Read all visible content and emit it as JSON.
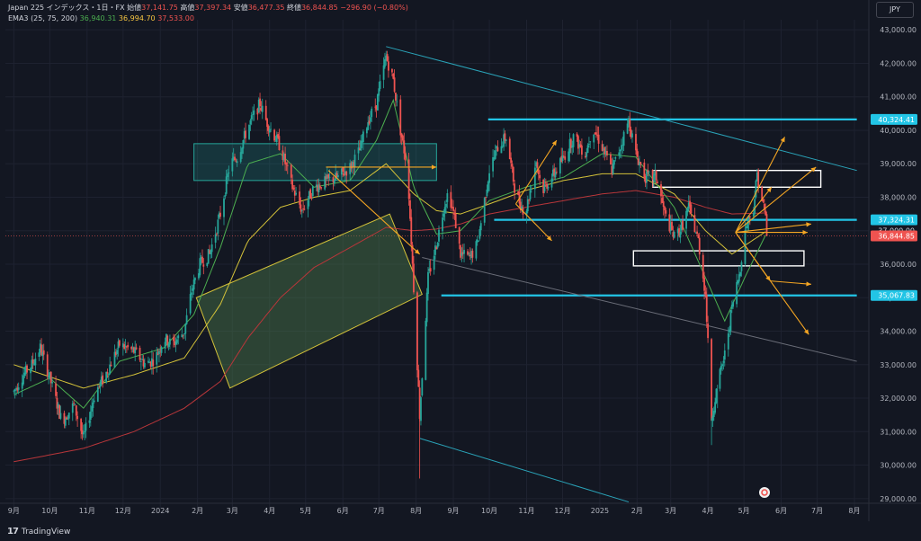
{
  "legend": {
    "symbol": "Japan 225 インデックス・1日・FX",
    "open_label": "始値",
    "open": "37,141.75",
    "high_label": "高値",
    "high": "37,397.34",
    "low_label": "安値",
    "low": "36,477.35",
    "close_label": "終値",
    "close": "36,844.85",
    "change": "−296.90 (−0.80%)",
    "ema_label": "EMA3 (25, 75, 200)",
    "ema1": "36,940.31",
    "ema2": "36,994.70",
    "ema3": "37,533.00"
  },
  "currency": "JPY",
  "brand": "TradingView",
  "colors": {
    "background": "#131722",
    "grid": "#1e2230",
    "up": "#26a69a",
    "down": "#ef5350",
    "ema25": "#4caf50",
    "ema75": "#d4c239",
    "ema200": "#b8363a",
    "level": "#22c5e6",
    "channel": "#2aa3b8",
    "arrow": "#f5a623",
    "box_green": "#4b7a4b"
  },
  "chart_data": {
    "type": "candlestick",
    "y_range": [
      28700,
      43300
    ],
    "y_ticks": [
      "29,000.00",
      "30,000.00",
      "31,000.00",
      "32,000.00",
      "33,000.00",
      "34,000.00",
      "35,000.00",
      "36,000.00",
      "37,000.00",
      "38,000.00",
      "39,000.00",
      "40,000.00",
      "41,000.00",
      "42,000.00",
      "43,000.00"
    ],
    "x_ticks": [
      "9月",
      "10月",
      "11月",
      "12月",
      "2024",
      "2月",
      "3月",
      "4月",
      "5月",
      "6月",
      "7月",
      "8月",
      "9月",
      "10月",
      "11月",
      "12月",
      "2025",
      "2月",
      "3月",
      "4月",
      "5月",
      "6月",
      "7月",
      "8月"
    ],
    "x_tick_days": [
      0,
      30,
      61,
      91,
      122,
      153,
      182,
      213,
      243,
      274,
      304,
      335,
      366,
      396,
      427,
      457,
      488,
      519,
      547,
      578,
      608,
      639,
      669,
      700
    ],
    "x_range": [
      -7,
      712
    ],
    "last_data_day": 627,
    "price_path": [
      [
        0,
        32200
      ],
      [
        8,
        32700
      ],
      [
        15,
        33000
      ],
      [
        22,
        33500
      ],
      [
        30,
        32600
      ],
      [
        40,
        31300
      ],
      [
        50,
        31800
      ],
      [
        58,
        30800
      ],
      [
        68,
        32200
      ],
      [
        75,
        32600
      ],
      [
        88,
        33600
      ],
      [
        100,
        33400
      ],
      [
        110,
        33000
      ],
      [
        118,
        33200
      ],
      [
        125,
        33800
      ],
      [
        132,
        33600
      ],
      [
        142,
        34000
      ],
      [
        148,
        35200
      ],
      [
        155,
        36000
      ],
      [
        163,
        36300
      ],
      [
        172,
        37500
      ],
      [
        180,
        39000
      ],
      [
        186,
        39200
      ],
      [
        195,
        40100
      ],
      [
        205,
        40800
      ],
      [
        210,
        40300
      ],
      [
        222,
        39500
      ],
      [
        232,
        38300
      ],
      [
        240,
        37600
      ],
      [
        250,
        38300
      ],
      [
        262,
        38500
      ],
      [
        270,
        38600
      ],
      [
        280,
        38900
      ],
      [
        288,
        39400
      ],
      [
        295,
        40300
      ],
      [
        302,
        40800
      ],
      [
        310,
        42200
      ],
      [
        316,
        41500
      ],
      [
        322,
        40000
      ],
      [
        328,
        38800
      ],
      [
        333,
        35300
      ],
      [
        338,
        31500
      ],
      [
        345,
        35600
      ],
      [
        352,
        36600
      ],
      [
        358,
        37700
      ],
      [
        362,
        38200
      ],
      [
        368,
        37200
      ],
      [
        372,
        36300
      ],
      [
        380,
        36200
      ],
      [
        386,
        36600
      ],
      [
        396,
        38800
      ],
      [
        403,
        39500
      ],
      [
        410,
        39800
      ],
      [
        418,
        38100
      ],
      [
        426,
        37500
      ],
      [
        435,
        39100
      ],
      [
        440,
        38200
      ],
      [
        448,
        38600
      ],
      [
        458,
        39200
      ],
      [
        466,
        39800
      ],
      [
        476,
        39300
      ],
      [
        482,
        40100
      ],
      [
        490,
        39500
      ],
      [
        498,
        38800
      ],
      [
        505,
        39500
      ],
      [
        512,
        40300
      ],
      [
        518,
        39300
      ],
      [
        526,
        38600
      ],
      [
        535,
        38600
      ],
      [
        542,
        37500
      ],
      [
        550,
        36800
      ],
      [
        556,
        37100
      ],
      [
        562,
        37700
      ],
      [
        570,
        36700
      ],
      [
        576,
        35100
      ],
      [
        581,
        31400
      ],
      [
        586,
        32400
      ],
      [
        592,
        33300
      ],
      [
        598,
        34700
      ],
      [
        604,
        35700
      ],
      [
        610,
        37200
      ],
      [
        616,
        37700
      ],
      [
        619,
        38700
      ],
      [
        622,
        38100
      ],
      [
        626,
        37400
      ],
      [
        627,
        36845
      ]
    ],
    "ema25_path": [
      [
        0,
        32100
      ],
      [
        30,
        32600
      ],
      [
        58,
        31700
      ],
      [
        88,
        33100
      ],
      [
        125,
        33500
      ],
      [
        150,
        34500
      ],
      [
        172,
        36500
      ],
      [
        195,
        39000
      ],
      [
        222,
        39300
      ],
      [
        250,
        38300
      ],
      [
        280,
        38500
      ],
      [
        302,
        39700
      ],
      [
        316,
        40900
      ],
      [
        333,
        38300
      ],
      [
        352,
        36900
      ],
      [
        372,
        37000
      ],
      [
        396,
        37900
      ],
      [
        426,
        38300
      ],
      [
        458,
        38600
      ],
      [
        490,
        39300
      ],
      [
        518,
        39200
      ],
      [
        550,
        37700
      ],
      [
        576,
        35600
      ],
      [
        592,
        34300
      ],
      [
        610,
        35700
      ],
      [
        627,
        36940
      ]
    ],
    "ema75_path": [
      [
        0,
        33000
      ],
      [
        58,
        32300
      ],
      [
        100,
        32700
      ],
      [
        142,
        33200
      ],
      [
        172,
        34800
      ],
      [
        195,
        36700
      ],
      [
        222,
        37700
      ],
      [
        250,
        38000
      ],
      [
        280,
        38200
      ],
      [
        310,
        39000
      ],
      [
        333,
        38100
      ],
      [
        352,
        37600
      ],
      [
        372,
        37500
      ],
      [
        396,
        37800
      ],
      [
        426,
        38200
      ],
      [
        458,
        38500
      ],
      [
        490,
        38700
      ],
      [
        518,
        38700
      ],
      [
        550,
        38100
      ],
      [
        576,
        37000
      ],
      [
        598,
        36300
      ],
      [
        627,
        36995
      ]
    ],
    "ema200_path": [
      [
        0,
        30100
      ],
      [
        58,
        30500
      ],
      [
        100,
        31000
      ],
      [
        142,
        31700
      ],
      [
        172,
        32500
      ],
      [
        195,
        33800
      ],
      [
        222,
        35000
      ],
      [
        250,
        35900
      ],
      [
        280,
        36500
      ],
      [
        310,
        37100
      ],
      [
        333,
        37000
      ],
      [
        352,
        37050
      ],
      [
        372,
        37200
      ],
      [
        396,
        37500
      ],
      [
        426,
        37700
      ],
      [
        458,
        37900
      ],
      [
        490,
        38100
      ],
      [
        518,
        38200
      ],
      [
        550,
        38000
      ],
      [
        576,
        37700
      ],
      [
        598,
        37500
      ],
      [
        627,
        37533
      ]
    ],
    "price_labels": [
      {
        "value": 40324.41,
        "text": "40,324.41",
        "color": "#22c5e6"
      },
      {
        "value": 37324.31,
        "text": "37,324.31",
        "color": "#22c5e6"
      },
      {
        "value": 37000.0,
        "text": "37,000.00",
        "color": "#d1d4dc"
      },
      {
        "value": 36844.85,
        "text": "36,844.85",
        "color": "#ef5350"
      },
      {
        "value": 35067.83,
        "text": "35,067.83",
        "color": "#22c5e6"
      }
    ],
    "horizontal_levels": [
      {
        "value": 40324.41,
        "from_day": 395,
        "to_day": 702
      },
      {
        "value": 37324.31,
        "from_day": 400,
        "to_day": 702
      },
      {
        "value": 35067.83,
        "from_day": 356,
        "to_day": 702
      }
    ],
    "channel_lines": [
      {
        "from": [
          310,
          42500
        ],
        "to": [
          702,
          38800
        ],
        "color": "#2aa3b8"
      },
      {
        "from": [
          338,
          30800
        ],
        "to": [
          512,
          28900
        ],
        "color": "#2aa3b8"
      },
      {
        "from": [
          340,
          36200
        ],
        "to": [
          702,
          33100
        ],
        "color": "#6a6d78"
      }
    ],
    "zones": [
      {
        "type": "rect",
        "day_from": 150,
        "day_to": 352,
        "price_from": 38500,
        "price_to": 39600,
        "color": "#26a69a"
      },
      {
        "type": "rect",
        "day_from": 532,
        "day_to": 672,
        "price_from": 38300,
        "price_to": 38800,
        "color": "#ffffff"
      },
      {
        "type": "rect",
        "day_from": 516,
        "day_to": 658,
        "price_from": 35950,
        "price_to": 36400,
        "color": "#ffffff"
      },
      {
        "type": "poly",
        "points": [
          [
            152,
            35000
          ],
          [
            313,
            37500
          ],
          [
            340,
            35100
          ],
          [
            180,
            32300
          ]
        ],
        "color": "#d4c239"
      }
    ],
    "arrows": [
      {
        "from": [
          260,
          38900
        ],
        "to": [
          352,
          38900
        ]
      },
      {
        "from": [
          262,
          38800
        ],
        "to": [
          338,
          36300
        ]
      },
      {
        "from": [
          418,
          37800
        ],
        "to": [
          448,
          36700
        ]
      },
      {
        "from": [
          418,
          37800
        ],
        "to": [
          452,
          39700
        ]
      },
      {
        "from": [
          601,
          36950
        ],
        "to": [
          631,
          38300
        ]
      },
      {
        "from": [
          601,
          36950
        ],
        "to": [
          642,
          39800
        ]
      },
      {
        "from": [
          601,
          36950
        ],
        "to": [
          668,
          38900
        ]
      },
      {
        "from": [
          601,
          36950
        ],
        "to": [
          664,
          37200
        ]
      },
      {
        "from": [
          601,
          36950
        ],
        "to": [
          661,
          36950
        ]
      },
      {
        "from": [
          601,
          36950
        ],
        "to": [
          630,
          35500
        ]
      },
      {
        "from": [
          630,
          35500
        ],
        "to": [
          664,
          35400
        ]
      },
      {
        "from": [
          601,
          36950
        ],
        "to": [
          662,
          33900
        ]
      }
    ]
  }
}
